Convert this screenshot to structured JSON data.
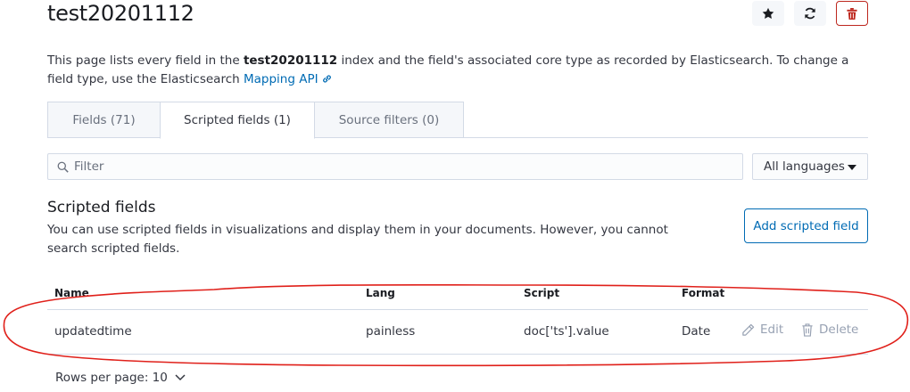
{
  "page": {
    "title": "test20201112",
    "intro_before": "This page lists every field in the ",
    "index_name": "test20201112",
    "intro_after": " index and the field's associated core type as recorded by Elasticsearch. To change a field type, use the Elasticsearch ",
    "mapping_link": "Mapping API"
  },
  "header_buttons": {
    "favorite_icon": "star-icon",
    "refresh_icon": "refresh-icon",
    "delete_icon": "trash-icon"
  },
  "tabs": [
    {
      "label": "Fields (71)",
      "active": false
    },
    {
      "label": "Scripted fields (1)",
      "active": true
    },
    {
      "label": "Source filters (0)",
      "active": false
    }
  ],
  "filter": {
    "placeholder": "Filter",
    "language_selected": "All languages"
  },
  "scripted_section": {
    "title": "Scripted fields",
    "description": "You can use scripted fields in visualizations and display them in your documents. However, you cannot search scripted fields.",
    "add_button": "Add scripted field"
  },
  "table": {
    "columns": [
      "Name",
      "Lang",
      "Script",
      "Format"
    ],
    "rows": [
      {
        "name": "updatedtime",
        "lang": "painless",
        "script": "doc['ts'].value",
        "format": "Date",
        "edit": "Edit",
        "delete": "Delete"
      }
    ]
  },
  "pagination": {
    "rows_per_page": "Rows per page: 10"
  },
  "colors": {
    "accent": "#006bb4",
    "danger": "#bd271e",
    "annotation": "#e0201a"
  }
}
